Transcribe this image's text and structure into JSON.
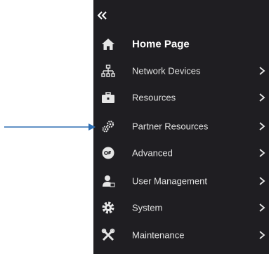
{
  "nav": {
    "collapse_icon": "double-chevron-left-icon",
    "items": [
      {
        "label": "Home Page",
        "icon": "home-icon",
        "has_submenu": false
      },
      {
        "label": "Network Devices",
        "icon": "network-icon",
        "has_submenu": true
      },
      {
        "label": "Resources",
        "icon": "briefcase-icon",
        "has_submenu": true
      },
      {
        "label": "Partner Resources",
        "icon": "gears-icon",
        "has_submenu": true
      },
      {
        "label": "Advanced",
        "icon": "advanced-icon",
        "has_submenu": true
      },
      {
        "label": "User Management",
        "icon": "user-icon",
        "has_submenu": true
      },
      {
        "label": "System",
        "icon": "gear-icon",
        "has_submenu": true
      },
      {
        "label": "Maintenance",
        "icon": "tools-icon",
        "has_submenu": true
      }
    ]
  },
  "colors": {
    "sidebar_bg": "#1f1e22",
    "text": "#e2e2e2",
    "annotation_arrow": "#2e6fb3"
  }
}
